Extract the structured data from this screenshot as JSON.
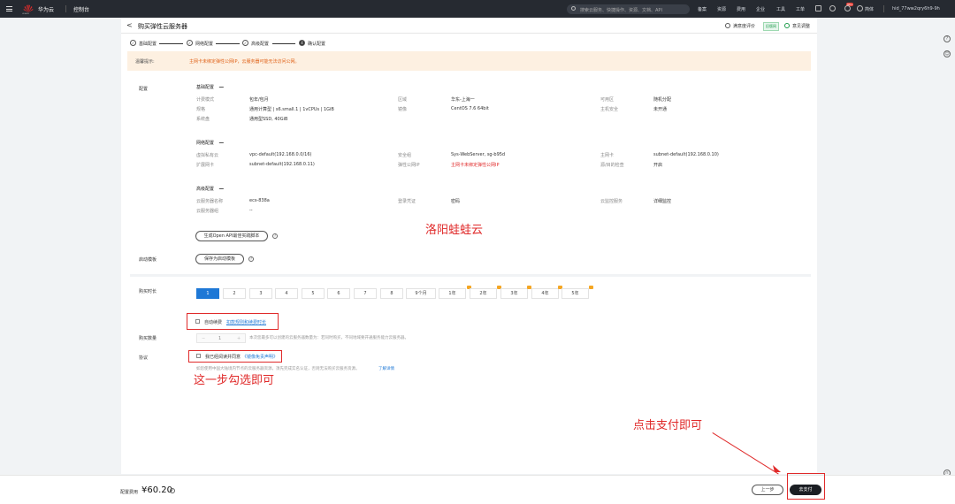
{
  "topbar": {
    "logo_text": "HUAWEI",
    "brand": "华为云",
    "console": "控制台",
    "search_placeholder": "搜索云服务、快捷操作、资源、文档、API",
    "nav": [
      "备案",
      "资源",
      "费用",
      "企业",
      "工具",
      "工单"
    ],
    "badge": "99+",
    "lang": "简体",
    "account": "hid_77ww2qry6h9-9h"
  },
  "header": {
    "back": "<",
    "title": "购买弹性云服务器",
    "satisfaction": "满意度评价",
    "old_version": "旧版网",
    "feedback": "意见调整"
  },
  "steps": [
    {
      "num": "✓",
      "label": "基础配置"
    },
    {
      "num": "✓",
      "label": "网络配置"
    },
    {
      "num": "✓",
      "label": "高级配置"
    },
    {
      "num": "4",
      "label": "确认配置"
    }
  ],
  "notice": {
    "label": "温馨提示:",
    "text": "主网卡未绑定弹性公网IP，云服务器可能无法访问公网。"
  },
  "config": {
    "section_label": "配置",
    "basic": {
      "title": "基础配置",
      "rows": [
        [
          {
            "l": "计费模式",
            "v": "包年/包月"
          },
          {
            "l": "区域",
            "v": "华东-上海一"
          },
          {
            "l": "可用区",
            "v": "随机分配"
          }
        ],
        [
          {
            "l": "规格",
            "v": "通用计算型 | s6.small.1 | 1vCPUs | 1GiB"
          },
          {
            "l": "镜像",
            "v": "CentOS 7.6 64bit"
          },
          {
            "l": "主机安全",
            "v": "未开通"
          }
        ],
        [
          {
            "l": "系统盘",
            "v": "通用型SSD, 40GiB"
          }
        ]
      ]
    },
    "network": {
      "title": "网络配置",
      "rows": [
        [
          {
            "l": "虚拟私有云",
            "v": "vpc-default(192.168.0.0/16)"
          },
          {
            "l": "安全组",
            "v": "Sys-WebServer, sg-b95d"
          },
          {
            "l": "主网卡",
            "v": "subnet-default(192.168.0.10)"
          }
        ],
        [
          {
            "l": "扩展网卡",
            "v": "subnet-default(192.168.0.11)"
          },
          {
            "l": "弹性公网IP",
            "v": "主网卡未绑定弹性公网IP"
          },
          {
            "l": "源/目的检查",
            "v": "开启"
          }
        ]
      ]
    },
    "advanced": {
      "title": "高级配置",
      "rows": [
        [
          {
            "l": "云服务器名称",
            "v": "ecs-838a"
          },
          {
            "l": "登录凭证",
            "v": "密码"
          },
          {
            "l": "云监控服务",
            "v": "详细监控"
          }
        ],
        [
          {
            "l": "云服务器组",
            "v": "--"
          }
        ]
      ]
    },
    "api_button": "生成Open API最佳实践脚本",
    "template_label": "启动模板",
    "template_button": "保存为启动模板"
  },
  "watermark": "洛阳蛙蛙云",
  "purchase": {
    "duration_label": "购买时长",
    "periods": [
      "1",
      "2",
      "3",
      "4",
      "5",
      "6",
      "7",
      "8",
      "9个月",
      "1年",
      "2年",
      "3年",
      "4年",
      "5年"
    ],
    "discount_periods": [
      "1年",
      "2年",
      "3年",
      "4年",
      "5年"
    ],
    "auto_renew": "自动续费",
    "auto_renew_link": "扣款规则和续费时长",
    "qty_label": "购买数量",
    "qty_minus": "−",
    "qty_value": "1",
    "qty_plus": "+",
    "qty_note": "本次您最多可以创建的云服务器数量为：若同时购买，不同地域要开通服务能力云服务器。",
    "agreement_label": "协议",
    "agreement_text": "我已经阅读并同意",
    "agreement_link": "《镜像免责声明》",
    "agreement_note": "如您使用中国大陆境内节点的云服务器资源，须先完成实名认证，否则无法购买云服务资源。",
    "agreement_more": "了解详情"
  },
  "annotations": {
    "check_tip": "这一步勾选即可",
    "pay_tip": "点击支付即可"
  },
  "bottom": {
    "price_label": "配置费用",
    "price": "¥60.20",
    "prev": "上一步",
    "pay": "去支付"
  },
  "colors": {
    "primary": "#1e78d6",
    "annotation_red": "#e02a2a",
    "notice_bg": "#fdf0e1",
    "dark": "#262a31"
  }
}
